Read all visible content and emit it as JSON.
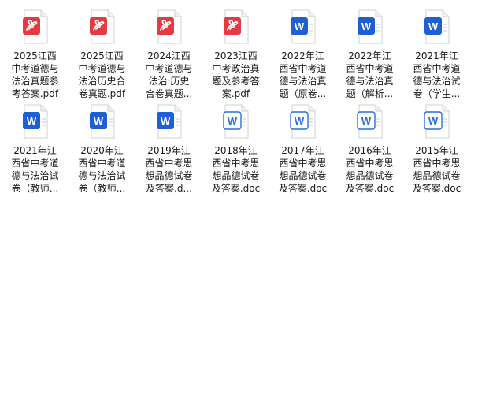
{
  "files": [
    {
      "name": "2025江西中考道德与法治真题参考答案.pdf",
      "type": "pdf",
      "icon": "pdf-file-icon",
      "label_lines": [
        "2025江西",
        "中考道德与",
        "法治真题参",
        "考答案.pdf"
      ]
    },
    {
      "name": "2025江西中考道德与法治历史合卷真题.pdf",
      "type": "pdf",
      "icon": "pdf-file-icon",
      "label_lines": [
        "2025江西",
        "中考道德与",
        "法治历史合",
        "卷真题.pdf"
      ]
    },
    {
      "name": "2024江西中考道德与法治·历史合卷真题…",
      "type": "pdf",
      "icon": "pdf-file-icon",
      "label_lines": [
        "2024江西",
        "中考道德与",
        "法治·历史",
        "合卷真题..."
      ]
    },
    {
      "name": "2023江西中考政治真题及参考答案.pdf",
      "type": "pdf",
      "icon": "pdf-file-icon",
      "label_lines": [
        "2023江西",
        "中考政治真",
        "题及参考答",
        "案.pdf"
      ]
    },
    {
      "name": "2022年江西省中考道德与法治真题（原卷…",
      "type": "word-filled",
      "icon": "word-file-icon",
      "label_lines": [
        "2022年江",
        "西省中考道",
        "德与法治真",
        "题（原卷..."
      ]
    },
    {
      "name": "2022年江西省中考道德与法治真题（解析…",
      "type": "word-filled",
      "icon": "word-file-icon",
      "label_lines": [
        "2022年江",
        "西省中考道",
        "德与法治真",
        "题（解析..."
      ]
    },
    {
      "name": "2021年江西省中考道德与法治试卷（学生…",
      "type": "word-filled",
      "icon": "word-file-icon",
      "label_lines": [
        "2021年江",
        "西省中考道",
        "德与法治试",
        "卷（学生..."
      ]
    },
    {
      "name": "2021年江西省中考道德与法治试卷（教师…",
      "type": "word-filled",
      "icon": "word-file-icon",
      "label_lines": [
        "2021年江",
        "西省中考道",
        "德与法治试",
        "卷（教师..."
      ]
    },
    {
      "name": "2020年江西省中考道德与法治试卷（教师…",
      "type": "word-filled",
      "icon": "word-file-icon",
      "label_lines": [
        "2020年江",
        "西省中考道",
        "德与法治试",
        "卷（教师..."
      ]
    },
    {
      "name": "2019年江西省中考思想品德试卷及答案.d…",
      "type": "word-filled",
      "icon": "word-file-icon",
      "label_lines": [
        "2019年江",
        "西省中考思",
        "想品德试卷",
        "及答案.d..."
      ]
    },
    {
      "name": "2018年江西省中考思想品德试卷及答案.doc",
      "type": "word-outline",
      "icon": "doc-file-icon",
      "label_lines": [
        "2018年江",
        "西省中考思",
        "想品德试卷",
        "及答案.doc"
      ]
    },
    {
      "name": "2017年江西省中考思想品德试卷及答案.doc",
      "type": "word-outline",
      "icon": "doc-file-icon",
      "label_lines": [
        "2017年江",
        "西省中考思",
        "想品德试卷",
        "及答案.doc"
      ]
    },
    {
      "name": "2016年江西省中考思想品德试卷及答案.doc",
      "type": "word-outline",
      "icon": "doc-file-icon",
      "label_lines": [
        "2016年江",
        "西省中考思",
        "想品德试卷",
        "及答案.doc"
      ]
    },
    {
      "name": "2015年江西省中考思想品德试卷及答案.doc",
      "type": "word-outline",
      "icon": "doc-file-icon",
      "label_lines": [
        "2015年江",
        "西省中考思",
        "想品德试卷",
        "及答案.doc"
      ]
    }
  ],
  "colors": {
    "pdf_red": "#e23b41",
    "word_blue": "#1f5fd6",
    "word_outline_blue": "#2b6fd8",
    "page_gray": "#e6e6e6",
    "text": "#1a1a1a"
  }
}
